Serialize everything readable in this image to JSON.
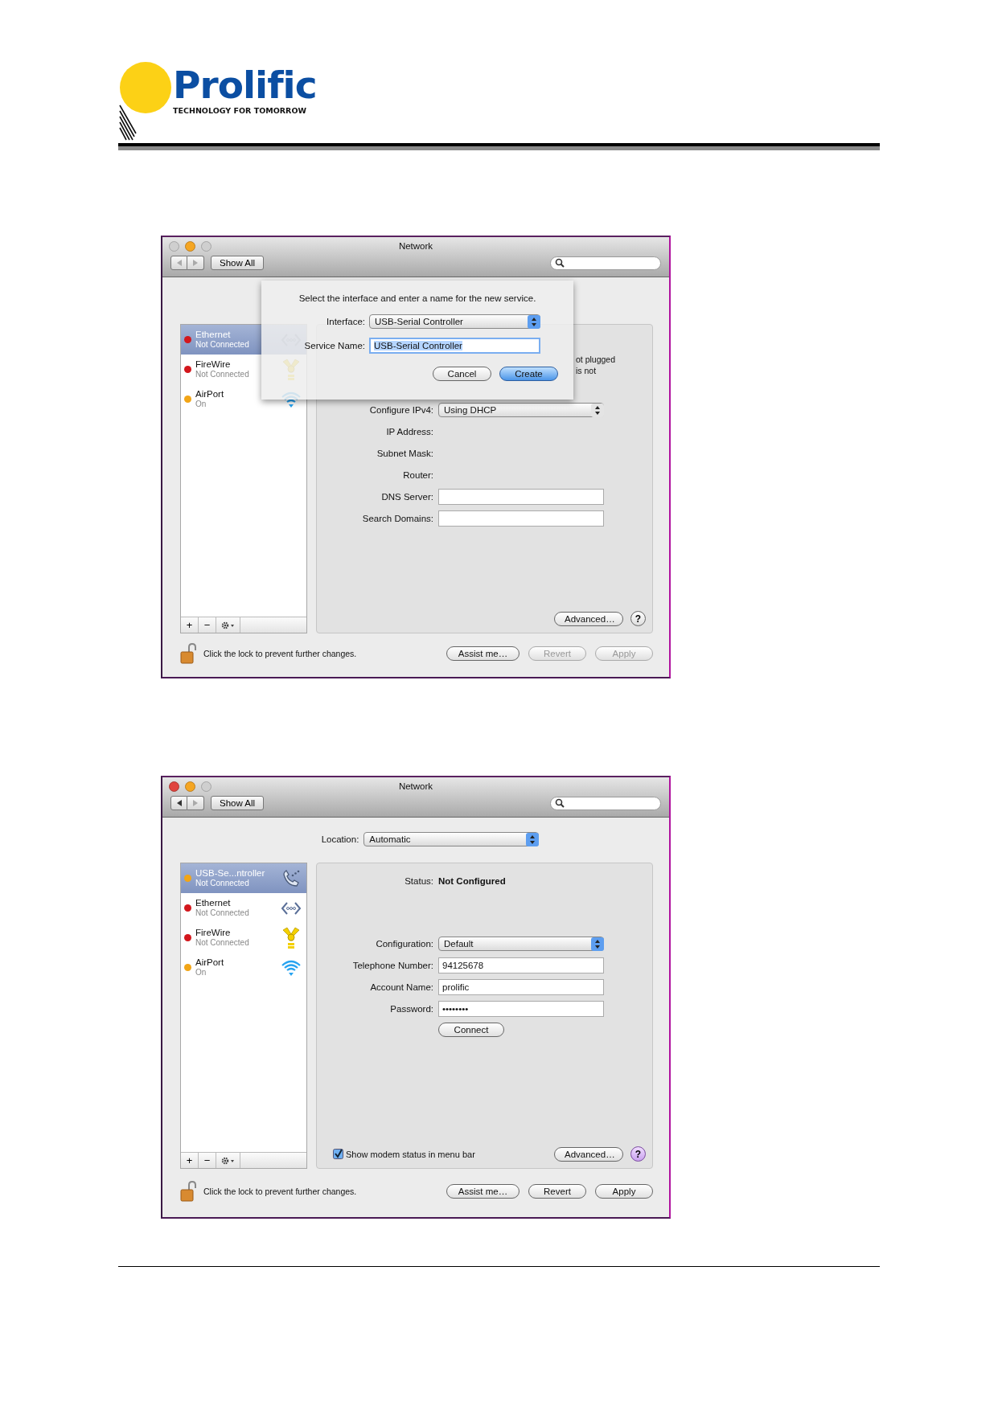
{
  "header": {
    "brand_name": "Prolific",
    "brand_tagline": "TECHNOLOGY FOR TOMORROW"
  },
  "window_1": {
    "title": "Network",
    "active": false,
    "back_enabled": false,
    "show_all": "Show All",
    "services": [
      {
        "name": "Ethernet",
        "status": "Not Connected",
        "color": "#d3161c",
        "kind": "ethernet",
        "selected": true
      },
      {
        "name": "FireWire",
        "status": "Not Connected",
        "color": "#d3161c",
        "kind": "firewire",
        "selected": false
      },
      {
        "name": "AirPort",
        "status": "On",
        "color": "#f2a516",
        "kind": "wifi",
        "selected": false
      }
    ],
    "add_button": "+",
    "remove_button": "−",
    "status_fragments": [
      "ot plugged",
      "is not"
    ],
    "fields": [
      {
        "kind": "select",
        "label": "Configure IPv4:",
        "value": "Using DHCP"
      },
      {
        "kind": "text",
        "label": "IP Address:"
      },
      {
        "kind": "text",
        "label": "Subnet Mask:"
      },
      {
        "kind": "text",
        "label": "Router:"
      },
      {
        "kind": "input",
        "label": "DNS Server:"
      },
      {
        "kind": "input",
        "label": "Search Domains:"
      }
    ],
    "advanced": "Advanced…",
    "help": {
      "label": "?",
      "highlighted": false
    },
    "lock_text": "Click the lock to prevent further changes.",
    "buttons": [
      {
        "label": "Assist me…",
        "disabled": false
      },
      {
        "label": "Revert",
        "disabled": true
      },
      {
        "label": "Apply",
        "disabled": true
      }
    ],
    "sheet": {
      "prompt": "Select the interface and enter a name for the new service.",
      "interface_label": "Interface:",
      "interface_value": "USB-Serial Controller",
      "service_label": "Service Name:",
      "service_value": "USB-Serial Controller",
      "text_selected": true,
      "buttons": [
        {
          "label": "Cancel",
          "default": false
        },
        {
          "label": "Create",
          "default": true
        }
      ]
    }
  },
  "window_2": {
    "title": "Network",
    "active": true,
    "back_enabled": true,
    "show_all": "Show All",
    "location_label": "Location:",
    "location_value": "Automatic",
    "services": [
      {
        "name": "USB-Se...ntroller",
        "status": "Not Connected",
        "color": "#f2a516",
        "kind": "phone",
        "selected": true
      },
      {
        "name": "Ethernet",
        "status": "Not Connected",
        "color": "#d3161c",
        "kind": "ethernet",
        "selected": false
      },
      {
        "name": "FireWire",
        "status": "Not Connected",
        "color": "#d3161c",
        "kind": "firewire",
        "selected": false
      },
      {
        "name": "AirPort",
        "status": "On",
        "color": "#f2a516",
        "kind": "wifi",
        "selected": false
      }
    ],
    "add_button": "+",
    "remove_button": "−",
    "status_label": "Status:",
    "status_value": "Not Configured",
    "fields": [
      {
        "kind": "select",
        "label": "Configuration:",
        "value": "Default"
      },
      {
        "kind": "input",
        "label": "Telephone Number:",
        "value": "94125678"
      },
      {
        "kind": "input",
        "label": "Account Name:",
        "value": "prolific"
      },
      {
        "kind": "input",
        "label": "Password:",
        "value": "••••••••"
      },
      {
        "kind": "button",
        "value": "Connect"
      }
    ],
    "checkbox": {
      "label": "Show modem status in menu bar",
      "checked": true
    },
    "advanced": "Advanced…",
    "help": {
      "label": "?",
      "highlighted": true
    },
    "lock_text": "Click the lock to prevent further changes.",
    "buttons": [
      {
        "label": "Assist me…",
        "disabled": false
      },
      {
        "label": "Revert",
        "disabled": false
      },
      {
        "label": "Apply",
        "disabled": false
      }
    ]
  }
}
